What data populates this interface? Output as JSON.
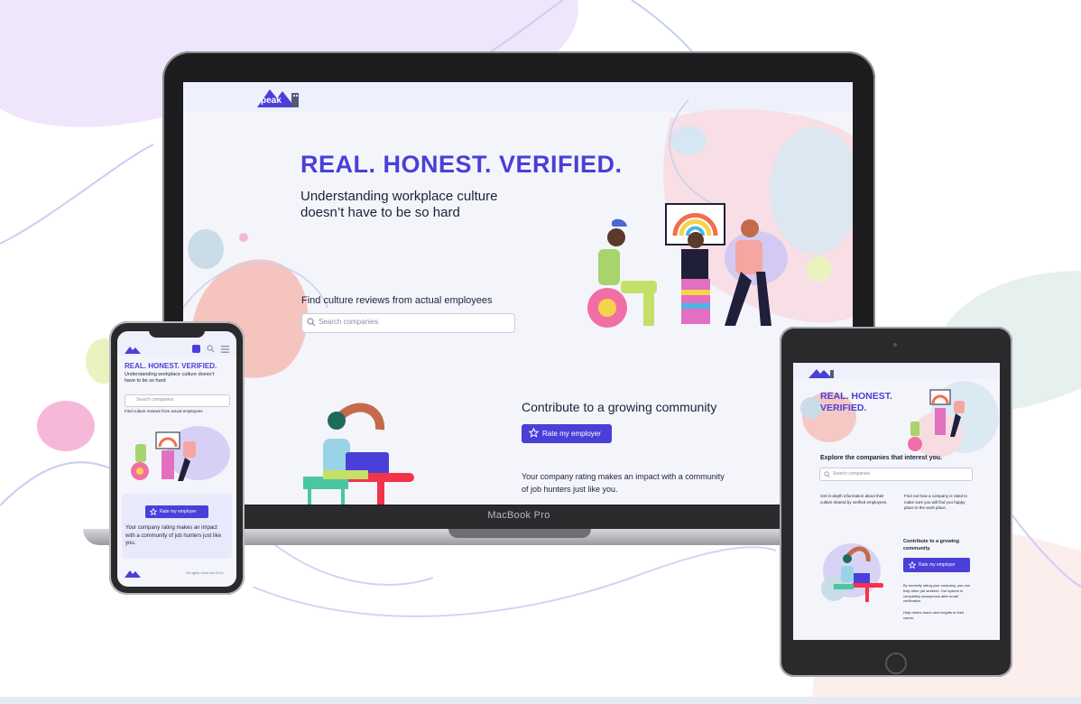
{
  "desktop": {
    "logo_text": "peak",
    "hero_title": "REAL.  HONEST.  VERIFIED.",
    "hero_subtitle": "Understanding workplace culture doesn’t have to be so hard",
    "find_label": "Find culture reviews from actual employees",
    "search_placeholder": "Search companies",
    "contribute_heading": "Contribute to a growing community",
    "rate_button": "Rate my employer",
    "impact_text": "Your company rating makes an impact with a community of job hunters just like you.",
    "laptop_label": "MacBook Pro"
  },
  "mobile": {
    "hero_title": "REAL.  HONEST.  VERIFIED.",
    "hero_subtitle": "Understanding workplace culture doesn’t have to be so hard",
    "search_placeholder": "Search companies",
    "find_label": "Find culture reviews from actual employees",
    "rate_button": "Rate my employer",
    "impact_text": "Your company rating makes an impact with a community of job hunters just like you.",
    "footer_text": "All rights reserved 2021"
  },
  "tablet": {
    "hero_title_1": "REAL.  HONEST.",
    "hero_title_2": "VERIFIED.",
    "explore_heading": "Explore the companies that interest you.",
    "search_placeholder": "Search companies",
    "col1": "Get in-depth information about their culture shared by verified employees.",
    "col2": "Find out how a company is rated to make sure you will find you happy place in the work place.",
    "contribute_heading": "Contribute to a growing community.",
    "rate_button": "Rate my employer",
    "honest_text": "By honestly rating your company, you can help other job seekers. Our system is completely anonymous after email verification.",
    "help_text": "Help others reach new heights in their career."
  },
  "colors": {
    "brand": "#4a3fd8",
    "text": "#1f1f3a",
    "screen_bg": "#f4f5fb"
  }
}
